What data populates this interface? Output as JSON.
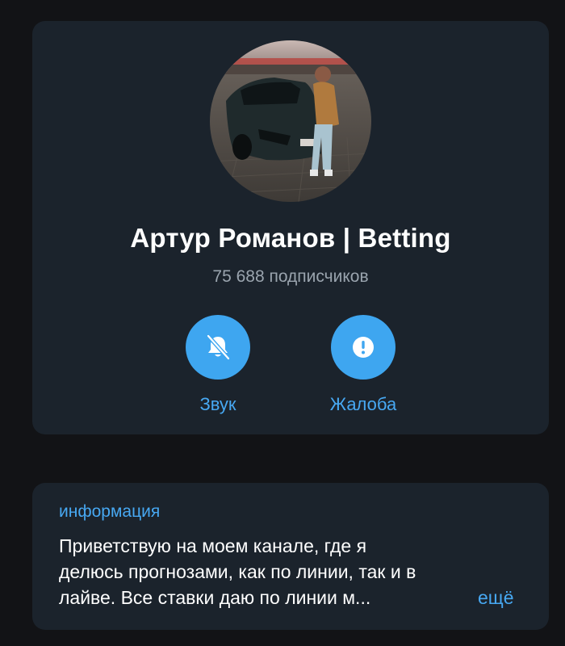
{
  "channel": {
    "title": "Артур Романов | Betting",
    "subscribers": "75 688 подписчиков"
  },
  "actions": [
    {
      "label": "Звук",
      "icon": "bell-off-icon"
    },
    {
      "label": "Жалоба",
      "icon": "exclamation-icon"
    }
  ],
  "info": {
    "heading": "информация",
    "lines": [
      "Приветствую на моем канале, где я",
      "делюсь прогнозами, как по линии, так и в",
      "лайве. Все ставки даю по линии м..."
    ],
    "more_label": "ещё"
  },
  "colors": {
    "background": "#121316",
    "card": "#1b232c",
    "accent": "#3ea6f0",
    "muted_text": "#9aa4ae"
  }
}
